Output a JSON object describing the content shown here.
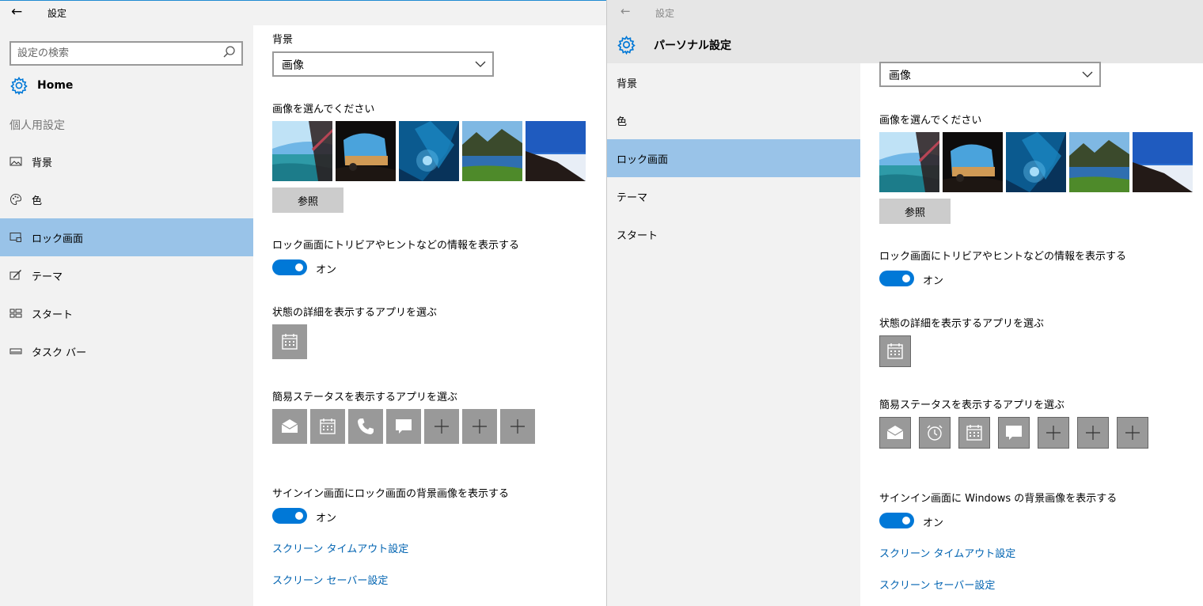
{
  "left": {
    "title": "設定",
    "search": {
      "placeholder": "設定の検索"
    },
    "home_label": "Home",
    "section_label": "個人用設定",
    "nav": [
      {
        "label": "背景",
        "icon": "image-icon"
      },
      {
        "label": "色",
        "icon": "palette-icon"
      },
      {
        "label": "ロック画面",
        "icon": "lock-screen-icon",
        "selected": true
      },
      {
        "label": "テーマ",
        "icon": "theme-icon"
      },
      {
        "label": "スタート",
        "icon": "start-icon"
      },
      {
        "label": "タスク バー",
        "icon": "taskbar-icon"
      }
    ],
    "content": {
      "background_heading": "背景",
      "background_value": "画像",
      "choose_picture_heading": "画像を選んでください",
      "browse_label": "参照",
      "trivia_heading": "ロック画面にトリビアやヒントなどの情報を表示する",
      "trivia_state": "オン",
      "detailed_status_heading": "状態の詳細を表示するアプリを選ぶ",
      "quick_status_heading": "簡易ステータスを表示するアプリを選ぶ",
      "quick_status_apps": [
        "mail-icon",
        "calendar-icon",
        "phone-icon",
        "message-icon",
        "plus-icon",
        "plus-icon",
        "plus-icon"
      ],
      "signin_heading": "サインイン画面にロック画面の背景画像を表示する",
      "signin_state": "オン",
      "timeout_link": "スクリーン タイムアウト設定",
      "screensaver_link": "スクリーン セーバー設定"
    }
  },
  "right": {
    "title": "設定",
    "header_title": "パーソナル設定",
    "nav": [
      {
        "label": "背景"
      },
      {
        "label": "色"
      },
      {
        "label": "ロック画面",
        "selected": true
      },
      {
        "label": "テーマ"
      },
      {
        "label": "スタート"
      }
    ],
    "content": {
      "background_value": "画像",
      "choose_picture_heading": "画像を選んでください",
      "browse_label": "参照",
      "trivia_heading": "ロック画面にトリビアやヒントなどの情報を表示する",
      "trivia_state": "オン",
      "detailed_status_heading": "状態の詳細を表示するアプリを選ぶ",
      "quick_status_heading": "簡易ステータスを表示するアプリを選ぶ",
      "quick_status_apps": [
        "mail-icon",
        "alarm-icon",
        "calendar-icon",
        "message-icon",
        "plus-icon",
        "plus-icon",
        "plus-icon"
      ],
      "signin_heading": "サインイン画面に Windows の背景画像を表示する",
      "signin_state": "オン",
      "timeout_link": "スクリーン タイムアウト設定",
      "screensaver_link": "スクリーン セーバー設定"
    }
  },
  "colors": {
    "accent": "#0078d7",
    "selected_nav": "#99c3e8",
    "link": "#0063b1",
    "sidebar_bg": "#f2f2f2",
    "tile_bg": "#999999"
  }
}
